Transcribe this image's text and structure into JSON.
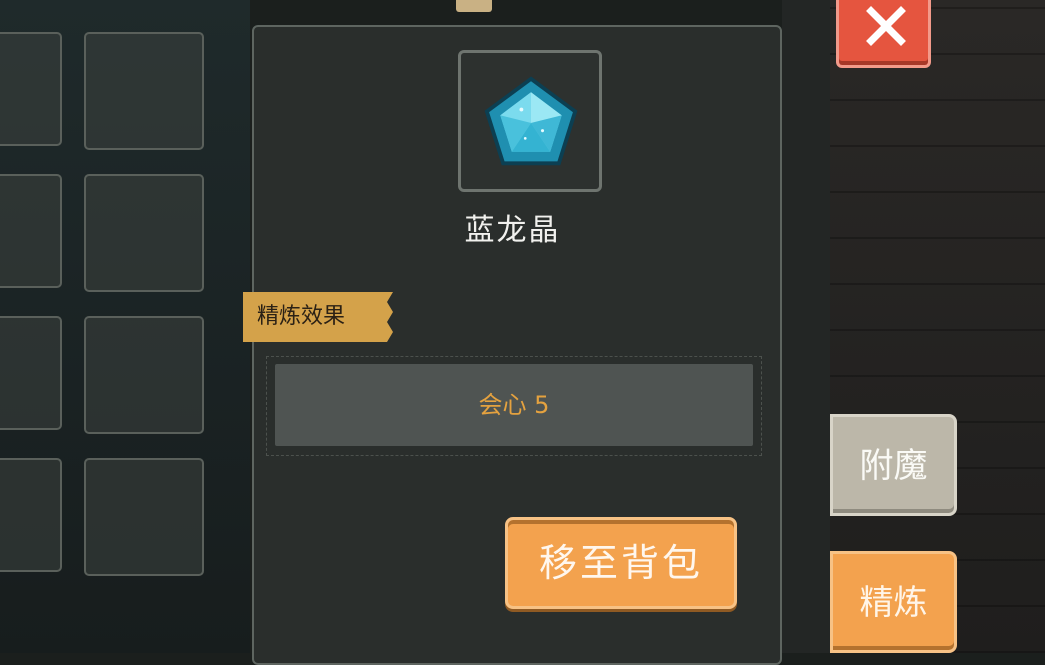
{
  "item": {
    "name": "蓝龙晶",
    "icon": "blue-pentagon-gem-icon"
  },
  "refine_effect": {
    "tag_label": "精炼效果",
    "value_text": "会心 5"
  },
  "actions": {
    "move_to_backpack_label": "移至背包"
  },
  "side_tabs": {
    "enchant_label": "附魔",
    "refine_label": "精炼"
  },
  "colors": {
    "accent_orange": "#f3a24e",
    "close_red": "#e5553f",
    "effect_text": "#e5a23f",
    "panel_bg": "#2a2e2c"
  }
}
